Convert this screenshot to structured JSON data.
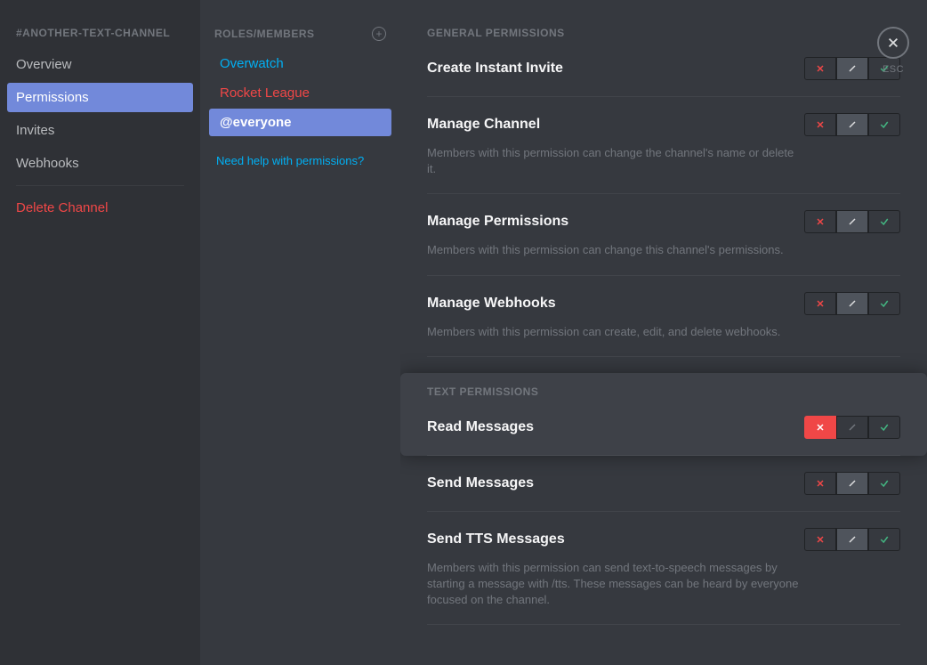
{
  "close_label": "ESC",
  "sidebar": {
    "header": "#ANOTHER-TEXT-CHANNEL",
    "items": [
      {
        "label": "Overview",
        "active": false
      },
      {
        "label": "Permissions",
        "active": true
      },
      {
        "label": "Invites",
        "active": false
      },
      {
        "label": "Webhooks",
        "active": false
      }
    ],
    "delete_label": "Delete Channel"
  },
  "roles": {
    "header": "ROLES/MEMBERS",
    "items": [
      {
        "label": "Overwatch",
        "color": "#00b0f4",
        "selected": false
      },
      {
        "label": "Rocket League",
        "color": "#f04747",
        "selected": false
      },
      {
        "label": "@everyone",
        "color": "#ffffff",
        "selected": true
      }
    ],
    "help_link": "Need help with permissions?"
  },
  "sections": [
    {
      "header": "GENERAL PERMISSIONS",
      "highlight": false,
      "perms": [
        {
          "title": "Create Instant Invite",
          "desc": "",
          "state": "neutral"
        },
        {
          "title": "Manage Channel",
          "desc": "Members with this permission can change the channel's name or delete it.",
          "state": "neutral"
        },
        {
          "title": "Manage Permissions",
          "desc": "Members with this permission can change this channel's permissions.",
          "state": "neutral"
        },
        {
          "title": "Manage Webhooks",
          "desc": "Members with this permission can create, edit, and delete webhooks.",
          "state": "neutral"
        }
      ]
    },
    {
      "header": "TEXT PERMISSIONS",
      "highlight": true,
      "perms": [
        {
          "title": "Read Messages",
          "desc": "",
          "state": "deny"
        }
      ]
    },
    {
      "header": "",
      "highlight": false,
      "perms": [
        {
          "title": "Send Messages",
          "desc": "",
          "state": "neutral"
        },
        {
          "title": "Send TTS Messages",
          "desc": "Members with this permission can send text-to-speech messages by starting a message with /tts. These messages can be heard by everyone focused on the channel.",
          "state": "neutral"
        }
      ]
    }
  ]
}
